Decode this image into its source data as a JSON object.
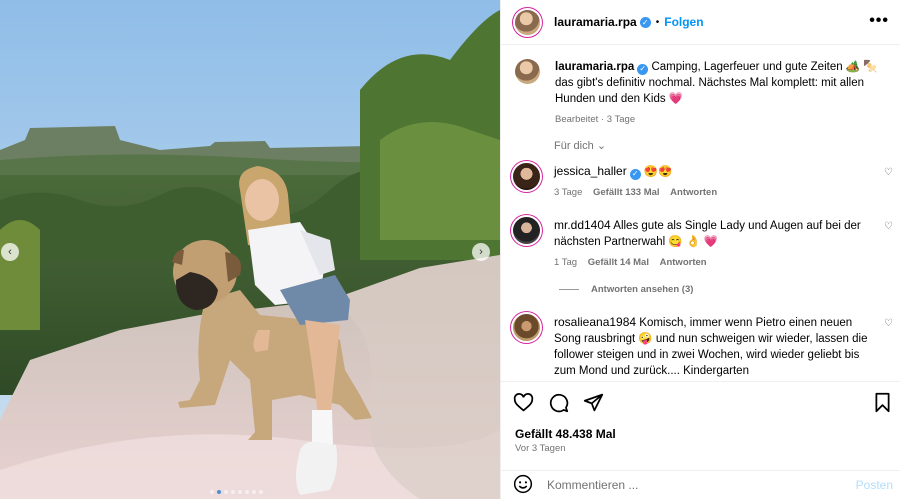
{
  "post": {
    "author": "lauramaria.rpa",
    "follow_label": "Folgen",
    "separator": "•",
    "more_label": "•••"
  },
  "caption": {
    "author": "lauramaria.rpa",
    "text": " Camping, Lagerfeuer und gute Zeiten 🏕️ 🍢 das gibt's definitiv nochmal. Nächstes Mal komplett: mit allen Hunden und den Kids 💗",
    "edited": "Bearbeitet · 3 Tage",
    "filter_label": "Für dich"
  },
  "comments": [
    {
      "author": "jessica_haller",
      "verified": true,
      "text": "😍😍",
      "time": "3 Tage",
      "likes": "Gefällt 133 Mal",
      "reply": "Antworten"
    },
    {
      "author": "mr.dd1404",
      "verified": false,
      "text": "Alles gute als Single Lady und Augen auf bei der nächsten Partnerwahl 😋 👌 💗",
      "time": "1 Tag",
      "likes": "Gefällt 14 Mal",
      "reply": "Antworten"
    },
    {
      "author": "rosalieana1984",
      "verified": false,
      "text": "Komisch, immer wenn Pietro einen neuen Song rausbringt 🤪 und nun schweigen wir wieder, lassen die follower steigen und in zwei Wochen, wird wieder geliebt bis zum Mond und zurück.... Kindergarten",
      "time": "",
      "likes": "",
      "reply": ""
    }
  ],
  "replies_label": "Antworten ansehen (3)",
  "stats": {
    "likes": "Gefällt 48.438 Mal",
    "date": "Vor 3 Tagen"
  },
  "compose": {
    "placeholder": "Kommentieren ...",
    "post_label": "Posten"
  },
  "carousel": {
    "slide_count": 8,
    "active_index": 1
  },
  "colors": {
    "accent": "#0095f6",
    "verified": "#3897f0",
    "muted": "#737373"
  }
}
